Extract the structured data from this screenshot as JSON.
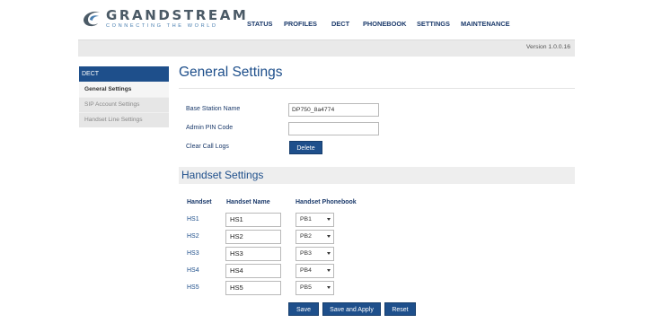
{
  "brand": {
    "name": "GRANDSTREAM",
    "tagline": "CONNECTING THE WORLD"
  },
  "topnav": {
    "items": [
      "STATUS",
      "PROFILES",
      "DECT",
      "PHONEBOOK",
      "SETTINGS",
      "MAINTENANCE"
    ]
  },
  "version": "Version 1.0.0.16",
  "sidebar": {
    "heading": "DECT",
    "items": [
      "General Settings",
      "SIP Account Settings",
      "Handset Line Settings"
    ]
  },
  "general": {
    "title": "General Settings",
    "base_station_label": "Base Station Name",
    "base_station_value": "DP750_8a4774",
    "admin_pin_label": "Admin PIN Code",
    "admin_pin_value": "",
    "clear_logs_label": "Clear Call Logs",
    "delete_label": "Delete"
  },
  "handset": {
    "title": "Handset Settings",
    "columns": [
      "Handset",
      "Handset Name",
      "Handset Phonebook"
    ],
    "rows": [
      {
        "id": "HS1",
        "name": "HS1",
        "phonebook": "PB1"
      },
      {
        "id": "HS2",
        "name": "HS2",
        "phonebook": "PB2"
      },
      {
        "id": "HS3",
        "name": "HS3",
        "phonebook": "PB3"
      },
      {
        "id": "HS4",
        "name": "HS4",
        "phonebook": "PB4"
      },
      {
        "id": "HS5",
        "name": "HS5",
        "phonebook": "PB5"
      }
    ]
  },
  "actions": {
    "save": "Save",
    "save_apply": "Save and Apply",
    "reset": "Reset"
  },
  "colors": {
    "primary": "#1e4f8b",
    "nav_text": "#1b3a6b",
    "bar_bg": "#e9e9e9"
  }
}
